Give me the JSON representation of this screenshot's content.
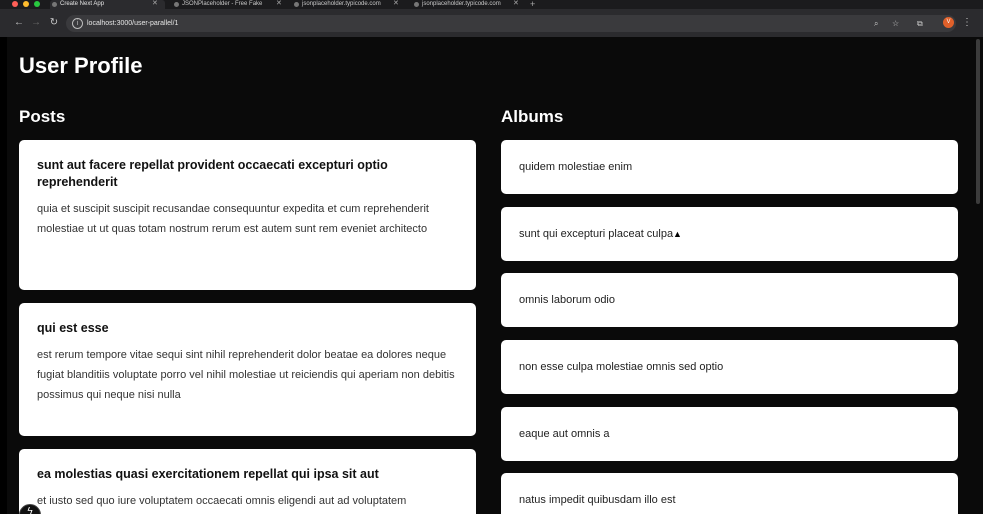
{
  "browser": {
    "tabs": [
      {
        "label": "Create Next App",
        "active": true
      },
      {
        "label": "JSONPlaceholder - Free Fake",
        "active": false
      },
      {
        "label": "jsonplaceholder.typicode.com",
        "active": false
      },
      {
        "label": "jsonplaceholder.typicode.com",
        "active": false
      }
    ],
    "new_tab_icon": "plus-icon",
    "url": "localhost:3000/user-parallel/1",
    "profile_initial": "V"
  },
  "page": {
    "title": "User Profile",
    "posts_heading": "Posts",
    "albums_heading": "Albums"
  },
  "posts": [
    {
      "title": "sunt aut facere repellat provident occaecati excepturi optio reprehenderit",
      "body": "quia et suscipit suscipit recusandae consequuntur expedita et cum reprehenderit molestiae ut ut quas totam nostrum rerum est autem sunt rem eveniet architecto"
    },
    {
      "title": "qui est esse",
      "body": "est rerum tempore vitae sequi sint nihil reprehenderit dolor beatae ea dolores neque fugiat blanditiis voluptate porro vel nihil molestiae ut reiciendis qui aperiam non debitis possimus qui neque nisi nulla"
    },
    {
      "title": "ea molestias quasi exercitationem repellat qui ipsa sit aut",
      "body": "et iusto sed quo iure voluptatem occaecati omnis eligendi aut ad voluptatem"
    }
  ],
  "albums": [
    {
      "title": "quidem molestiae enim"
    },
    {
      "title": "sunt qui excepturi placeat culpa"
    },
    {
      "title": "omnis laborum odio"
    },
    {
      "title": "non esse culpa molestiae omnis sed optio"
    },
    {
      "title": "eaque aut omnis a"
    },
    {
      "title": "natus impedit quibusdam illo est"
    }
  ],
  "colors": {
    "page_background": "#0a0a0a",
    "card_background": "#ffffff",
    "heading_text": "#ffffff",
    "profile_avatar": "#e0602a"
  }
}
